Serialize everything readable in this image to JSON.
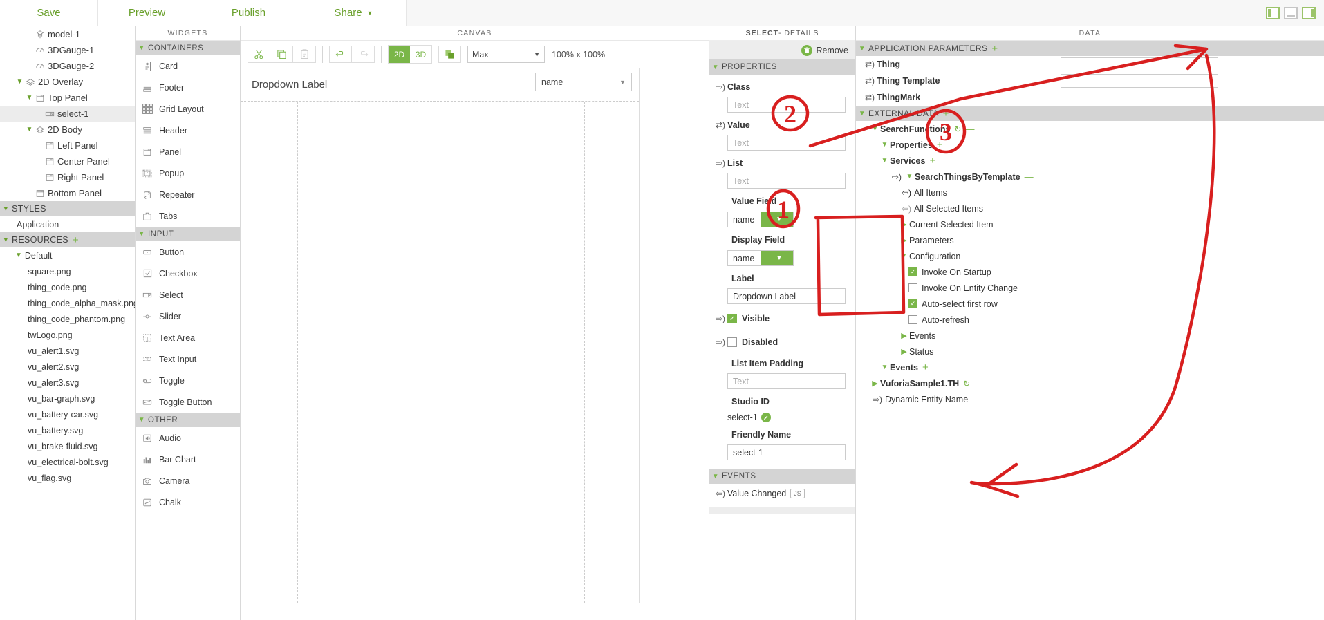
{
  "topbar": {
    "items": [
      {
        "label": "Save",
        "caret": false
      },
      {
        "label": "Preview",
        "caret": false
      },
      {
        "label": "Publish",
        "caret": false
      },
      {
        "label": "Share",
        "caret": true
      }
    ],
    "layout_icons": [
      "left-pane-toggle-icon",
      "bottom-pane-toggle-icon",
      "right-pane-toggle-icon"
    ]
  },
  "left_tree": {
    "nodes": [
      {
        "label": "model-1",
        "indent": 2,
        "twisty": "",
        "icon": "model-icon"
      },
      {
        "label": "3DGauge-1",
        "indent": 2,
        "twisty": "",
        "icon": "gauge-icon"
      },
      {
        "label": "3DGauge-2",
        "indent": 2,
        "twisty": "",
        "icon": "gauge-icon"
      },
      {
        "label": "2D Overlay",
        "indent": 1,
        "twisty": "⌄",
        "icon": "layers-icon"
      },
      {
        "label": "Top Panel",
        "indent": 2,
        "twisty": "⌄",
        "icon": "panel-icon"
      },
      {
        "label": "select-1",
        "indent": 3,
        "twisty": "",
        "icon": "select-widget-icon",
        "selected": true
      },
      {
        "label": "2D Body",
        "indent": 2,
        "twisty": "⌄",
        "icon": "layers-icon"
      },
      {
        "label": "Left Panel",
        "indent": 3,
        "twisty": "",
        "icon": "panel-icon"
      },
      {
        "label": "Center Panel",
        "indent": 3,
        "twisty": "",
        "icon": "panel-icon"
      },
      {
        "label": "Right Panel",
        "indent": 3,
        "twisty": "",
        "icon": "panel-icon"
      },
      {
        "label": "Bottom Panel",
        "indent": 2,
        "twisty": "",
        "icon": "panel-icon"
      }
    ],
    "styles_section": "STYLES",
    "styles_items": [
      "Application"
    ],
    "resources_section": "RESOURCES",
    "resources_group": "Default",
    "resources": [
      "square.png",
      "thing_code.png",
      "thing_code_alpha_mask.png",
      "thing_code_phantom.png",
      "twLogo.png",
      "vu_alert1.svg",
      "vu_alert2.svg",
      "vu_alert3.svg",
      "vu_bar-graph.svg",
      "vu_battery-car.svg",
      "vu_battery.svg",
      "vu_brake-fluid.svg",
      "vu_electrical-bolt.svg",
      "vu_flag.svg"
    ]
  },
  "widgets": {
    "title": "WIDGETS",
    "groups": [
      {
        "name": "CONTAINERS",
        "items": [
          {
            "label": "Card",
            "icon": "card-icon"
          },
          {
            "label": "Footer",
            "icon": "footer-icon"
          },
          {
            "label": "Grid Layout",
            "icon": "grid-layout-icon"
          },
          {
            "label": "Header",
            "icon": "header-icon"
          },
          {
            "label": "Panel",
            "icon": "panel-icon"
          },
          {
            "label": "Popup",
            "icon": "popup-icon"
          },
          {
            "label": "Repeater",
            "icon": "repeater-icon"
          },
          {
            "label": "Tabs",
            "icon": "tabs-icon"
          }
        ]
      },
      {
        "name": "INPUT",
        "items": [
          {
            "label": "Button",
            "icon": "button-icon"
          },
          {
            "label": "Checkbox",
            "icon": "checkbox-icon"
          },
          {
            "label": "Select",
            "icon": "select-icon"
          },
          {
            "label": "Slider",
            "icon": "slider-icon"
          },
          {
            "label": "Text Area",
            "icon": "text-area-icon"
          },
          {
            "label": "Text Input",
            "icon": "text-input-icon"
          },
          {
            "label": "Toggle",
            "icon": "toggle-icon"
          },
          {
            "label": "Toggle Button",
            "icon": "toggle-button-icon"
          }
        ]
      },
      {
        "name": "OTHER",
        "items": [
          {
            "label": "Audio",
            "icon": "audio-icon"
          },
          {
            "label": "Bar Chart",
            "icon": "bar-chart-icon"
          },
          {
            "label": "Camera",
            "icon": "camera-icon"
          },
          {
            "label": "Chalk",
            "icon": "chalk-icon"
          }
        ]
      }
    ]
  },
  "canvas": {
    "title": "CANVAS",
    "toolbar": {
      "cut": "cut-icon",
      "copy": "copy-icon",
      "paste": "paste-icon",
      "undo": "undo-icon",
      "redo": "redo-icon",
      "mode_2d": "2D",
      "mode_3d": "3D",
      "mode_active": "2D",
      "overlay_icon": "overlay-toggle-icon",
      "zoom_value": "Max",
      "zoom_ratio": "100% x 100%"
    },
    "widget_label": "Dropdown Label",
    "widget_select_value": "name"
  },
  "details": {
    "title_bold": "SELECT",
    "title_rest": " - DETAILS",
    "remove_label": "Remove",
    "properties_section": "PROPERTIES",
    "properties": [
      {
        "label": "Class",
        "placeholder": "Text",
        "bind": "out",
        "type": "text"
      },
      {
        "label": "Value",
        "placeholder": "Text",
        "bind": "both",
        "type": "text"
      },
      {
        "label": "List",
        "placeholder": "Text",
        "bind": "out",
        "type": "text"
      }
    ],
    "value_field": {
      "label": "Value Field",
      "value": "name"
    },
    "display_field": {
      "label": "Display Field",
      "value": "name"
    },
    "label_field": {
      "label": "Label",
      "value": "Dropdown Label"
    },
    "visible": {
      "label": "Visible",
      "checked": true
    },
    "disabled": {
      "label": "Disabled",
      "checked": false
    },
    "list_item_padding": {
      "label": "List Item Padding",
      "placeholder": "Text"
    },
    "studio_id": {
      "label": "Studio ID",
      "value": "select-1"
    },
    "friendly_name": {
      "label": "Friendly Name",
      "value": "select-1"
    },
    "events_section": "EVENTS",
    "events": [
      {
        "label": "Value Changed",
        "badge": "JS"
      }
    ]
  },
  "data": {
    "title": "DATA",
    "app_params_section": "APPLICATION PARAMETERS",
    "app_params": [
      {
        "label": "Thing",
        "value": ""
      },
      {
        "label": "Thing Template",
        "value": ""
      },
      {
        "label": "ThingMark",
        "value": ""
      }
    ],
    "external_data_section": "EXTERNAL DATA",
    "tree": [
      {
        "label": "SearchFunctions",
        "indent": 1,
        "twisty": "down",
        "bold": true,
        "refresh": true,
        "minus": true
      },
      {
        "label": "Properties",
        "indent": 2,
        "twisty": "down",
        "bold": true,
        "plus": true
      },
      {
        "label": "Services",
        "indent": 2,
        "twisty": "down",
        "bold": true,
        "plus": true
      },
      {
        "label": "SearchThingsByTemplate",
        "indent": 3,
        "twisty": "down",
        "bold": true,
        "bind": "out",
        "minus": true
      },
      {
        "label": "All Items",
        "indent": 4,
        "twisty": "",
        "bind": "in"
      },
      {
        "label": "All Selected Items",
        "indent": 4,
        "twisty": "",
        "bind": "in-grey"
      },
      {
        "label": "Current Selected Item",
        "indent": 4,
        "twisty": "right"
      },
      {
        "label": "Parameters",
        "indent": 4,
        "twisty": "right"
      },
      {
        "label": "Configuration",
        "indent": 4,
        "twisty": "down"
      },
      {
        "label": "Invoke On Startup",
        "indent": 5,
        "checkbox": true,
        "checked": true
      },
      {
        "label": "Invoke On Entity Change",
        "indent": 5,
        "checkbox": true,
        "checked": false
      },
      {
        "label": "Auto-select first row",
        "indent": 5,
        "checkbox": true,
        "checked": true
      },
      {
        "label": "Auto-refresh",
        "indent": 5,
        "checkbox": true,
        "checked": false
      },
      {
        "label": "Events",
        "indent": 4,
        "twisty": "right"
      },
      {
        "label": "Status",
        "indent": 4,
        "twisty": "right"
      },
      {
        "label": "Events",
        "indent": 2,
        "twisty": "down",
        "bold": true,
        "plus": true
      },
      {
        "label": "VuforiaSample1.TH",
        "indent": 1,
        "twisty": "right",
        "bold": true,
        "refresh": true,
        "minus": true
      },
      {
        "label": "Dynamic Entity Name",
        "indent": 1,
        "twisty": "",
        "bind": "out"
      }
    ]
  },
  "annotations": {
    "marks": [
      "1",
      "2",
      "3"
    ],
    "color": "#d81f1f"
  },
  "colors": {
    "accent_green": "#7ab648",
    "link_green": "#6aa02c",
    "section_grey": "#d4d4d4",
    "annotation_red": "#d81f1f"
  }
}
